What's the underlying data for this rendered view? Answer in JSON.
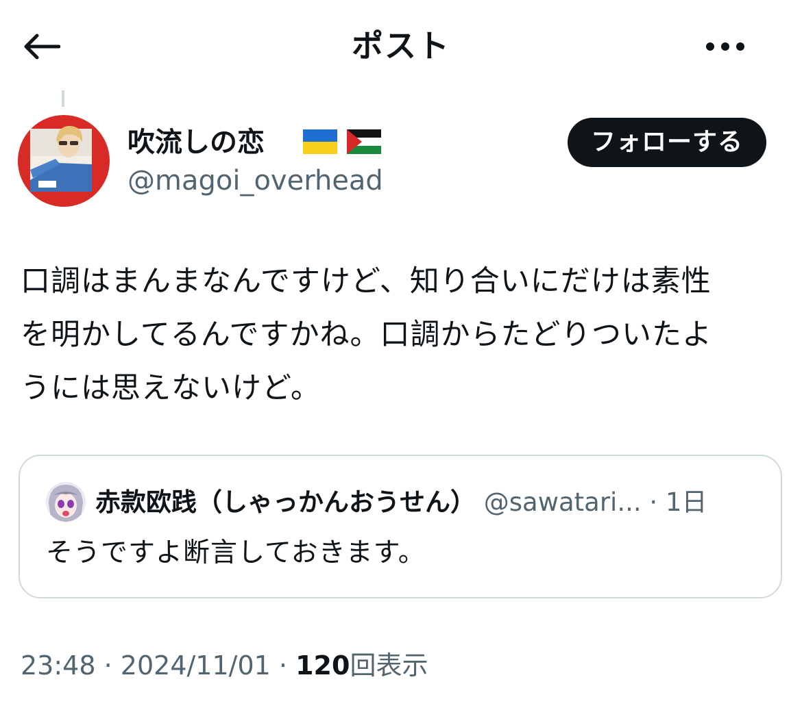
{
  "header": {
    "title": "ポスト",
    "back_icon": "arrow-left-icon",
    "more_icon": "more-horizontal-icon"
  },
  "author": {
    "display_name": "吹流しの恋",
    "flags": [
      "ukraine-flag-icon",
      "palestine-flag-icon"
    ],
    "handle": "@magoi_overhead",
    "follow_label": "フォローする"
  },
  "post": {
    "text": "口調はまんまなんですけど、知り合いにだけは素性\nを明かしてるんですかね。口調からたどりついたよ\nうには思えないけど。"
  },
  "quote": {
    "display_name": "赤款欧践（しゃっかんおうせん）",
    "handle": "@sawatari...",
    "separator": "·",
    "time": "1日",
    "text": "そうですよ断言しておきます。"
  },
  "meta": {
    "time": "23:48",
    "separator": "·",
    "date": "2024/11/01",
    "view_count": "120",
    "view_label": "回表示"
  },
  "colors": {
    "text_primary": "#0f1419",
    "text_secondary": "#536471",
    "border": "#cfd9de",
    "button_bg": "#0f1419"
  }
}
